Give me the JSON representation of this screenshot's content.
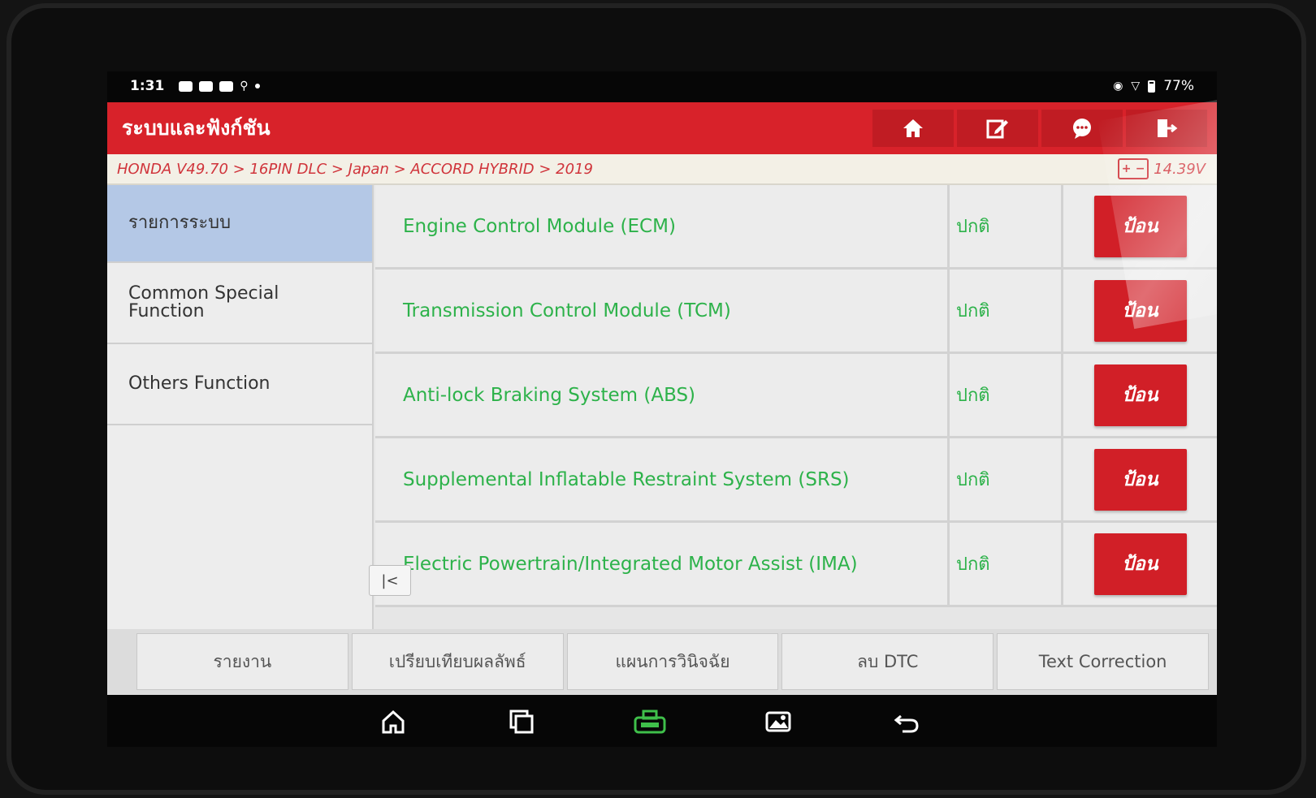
{
  "status_bar": {
    "time": "1:31",
    "battery": "77%"
  },
  "header": {
    "title": "ระบบและฟังก์ชัน",
    "tools": [
      {
        "icon": "home-icon"
      },
      {
        "icon": "edit-icon"
      },
      {
        "icon": "chat-icon"
      },
      {
        "icon": "exit-icon"
      }
    ]
  },
  "breadcrumb": {
    "path": "HONDA V49.70 > 16PIN DLC > Japan > ACCORD HYBRID > 2019",
    "voltage": "14.39V"
  },
  "sidebar": {
    "items": [
      {
        "label": "รายการระบบ",
        "active": true
      },
      {
        "label": "Common Special Function",
        "active": false
      },
      {
        "label": "Others Function",
        "active": false
      }
    ]
  },
  "systems": [
    {
      "name": "Engine Control Module (ECM)",
      "status": "ปกติ",
      "action": "ป้อน"
    },
    {
      "name": "Transmission Control Module (TCM)",
      "status": "ปกติ",
      "action": "ป้อน"
    },
    {
      "name": "Anti-lock Braking System (ABS)",
      "status": "ปกติ",
      "action": "ป้อน"
    },
    {
      "name": "Supplemental Inflatable Restraint System (SRS)",
      "status": "ปกติ",
      "action": "ป้อน"
    },
    {
      "name": "Electric Powertrain/Integrated Motor Assist (IMA)",
      "status": "ปกติ",
      "action": "ป้อน"
    }
  ],
  "bottom_buttons": [
    "รายงาน",
    "เปรียบเทียบผลลัพธ์",
    "แผนการวินิจฉัย",
    "ลบ DTC",
    "Text Correction"
  ],
  "colors": {
    "brand_red": "#d8222a",
    "status_green": "#2db24a",
    "active_sidebar": "#b4c8e6"
  }
}
